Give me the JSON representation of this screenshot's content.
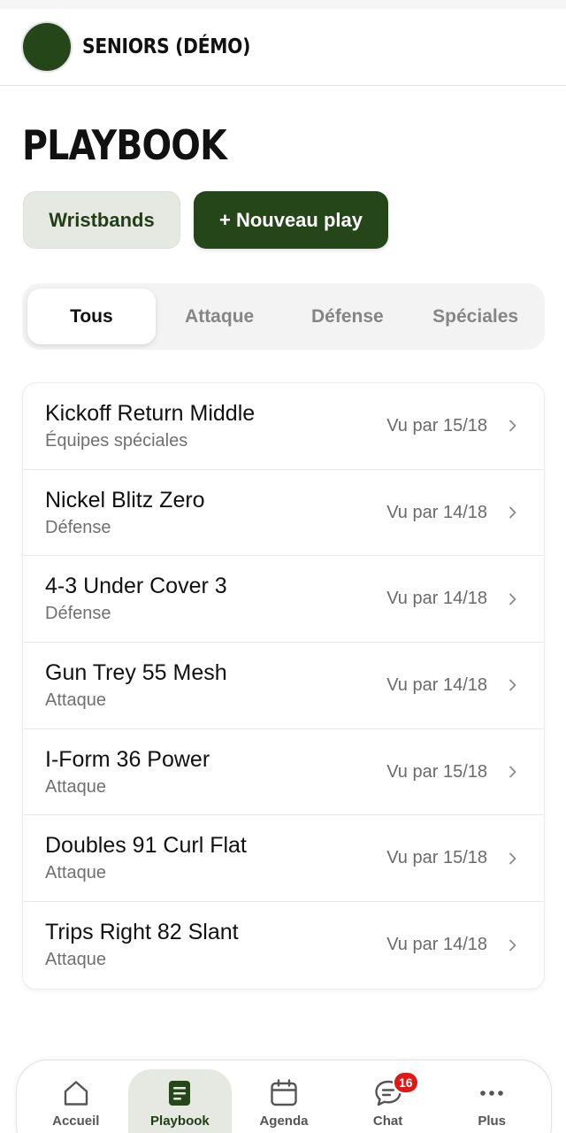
{
  "header": {
    "team_name": "SENIORS (DÉMO)"
  },
  "page": {
    "title": "PLAYBOOK"
  },
  "actions": {
    "wristbands_label": "Wristbands",
    "new_play_label": "+ Nouveau play"
  },
  "tabs": [
    {
      "label": "Tous",
      "active": true
    },
    {
      "label": "Attaque",
      "active": false
    },
    {
      "label": "Défense",
      "active": false
    },
    {
      "label": "Spéciales",
      "active": false
    }
  ],
  "plays": [
    {
      "name": "Kickoff Return Middle",
      "category": "Équipes spéciales",
      "views": "Vu par 15/18"
    },
    {
      "name": "Nickel Blitz Zero",
      "category": "Défense",
      "views": "Vu par 14/18"
    },
    {
      "name": "4-3 Under Cover 3",
      "category": "Défense",
      "views": "Vu par 14/18"
    },
    {
      "name": "Gun Trey 55 Mesh",
      "category": "Attaque",
      "views": "Vu par 14/18"
    },
    {
      "name": "I-Form 36 Power",
      "category": "Attaque",
      "views": "Vu par 15/18"
    },
    {
      "name": "Doubles 91 Curl Flat",
      "category": "Attaque",
      "views": "Vu par 15/18"
    },
    {
      "name": "Trips Right 82 Slant",
      "category": "Attaque",
      "views": "Vu par 14/18"
    }
  ],
  "nav": {
    "items": [
      {
        "label": "Accueil",
        "icon": "home-icon",
        "active": false
      },
      {
        "label": "Playbook",
        "icon": "playbook-icon",
        "active": true
      },
      {
        "label": "Agenda",
        "icon": "calendar-icon",
        "active": false
      },
      {
        "label": "Chat",
        "icon": "chat-icon",
        "active": false,
        "badge": "16"
      },
      {
        "label": "Plus",
        "icon": "more-icon",
        "active": false
      }
    ]
  },
  "colors": {
    "brand": "#254619",
    "brand_light": "#e6e9e2",
    "badge": "#e01818"
  }
}
